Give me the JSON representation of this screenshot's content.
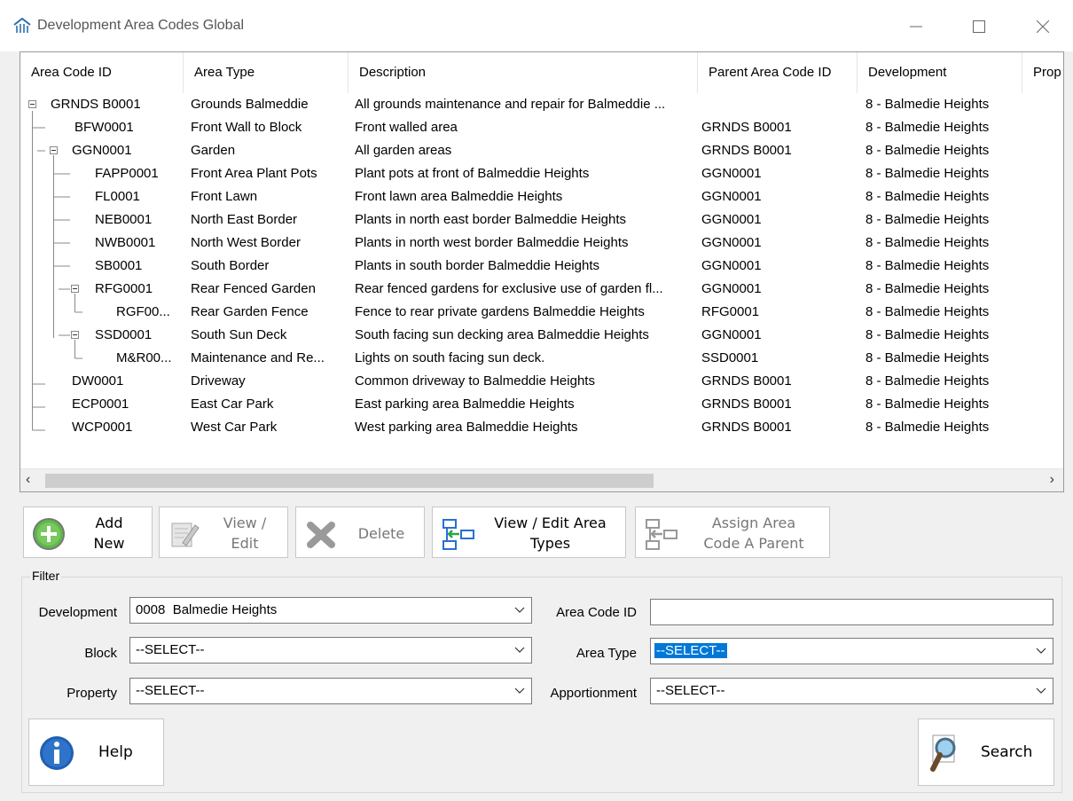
{
  "window": {
    "title": "Development Area Codes Global",
    "icon": "app-building-icon",
    "controls": [
      "minimize-icon",
      "maximize-icon",
      "close-icon"
    ]
  },
  "grid": {
    "columns": [
      "Area Code ID",
      "Area Type",
      "Description",
      "Parent Area Code ID",
      "Development",
      "Prop"
    ],
    "rows": [
      {
        "id": "GRNDS B0001",
        "type": "Grounds Balmeddie",
        "desc": "All grounds maintenance and repair for Balmeddie ...",
        "parent": "",
        "dev": "8 - Balmedie Heights"
      },
      {
        "id": "BFW0001",
        "type": "Front Wall to Block",
        "desc": "Front walled area",
        "parent": "GRNDS B0001",
        "dev": "8 - Balmedie Heights"
      },
      {
        "id": "GGN0001",
        "type": "Garden",
        "desc": "All garden areas",
        "parent": "GRNDS B0001",
        "dev": "8 - Balmedie Heights"
      },
      {
        "id": "FAPP0001",
        "type": "Front Area Plant Pots",
        "desc": "Plant pots at front of Balmeddie Heights",
        "parent": "GGN0001",
        "dev": "8 - Balmedie Heights"
      },
      {
        "id": "FL0001",
        "type": "Front Lawn",
        "desc": "Front lawn area Balmeddie Heights",
        "parent": "GGN0001",
        "dev": "8 - Balmedie Heights"
      },
      {
        "id": "NEB0001",
        "type": "North East Border",
        "desc": "Plants in north east border Balmeddie Heights",
        "parent": "GGN0001",
        "dev": "8 - Balmedie Heights"
      },
      {
        "id": "NWB0001",
        "type": "North West Border",
        "desc": "Plants in north west border Balmeddie Heights",
        "parent": "GGN0001",
        "dev": "8 - Balmedie Heights"
      },
      {
        "id": "SB0001",
        "type": "South Border",
        "desc": "Plants in south border Balmeddie Heights",
        "parent": "GGN0001",
        "dev": "8 - Balmedie Heights"
      },
      {
        "id": "RFG0001",
        "type": "Rear Fenced Garden",
        "desc": "Rear fenced gardens for exclusive use of garden fl...",
        "parent": "GGN0001",
        "dev": "8 - Balmedie Heights"
      },
      {
        "id": "RGF00...",
        "type": "Rear Garden Fence",
        "desc": "Fence to rear private gardens Balmeddie Heights",
        "parent": "RFG0001",
        "dev": "8 - Balmedie Heights"
      },
      {
        "id": "SSD0001",
        "type": "South Sun Deck",
        "desc": "South facing sun decking area Balmeddie Heights",
        "parent": "GGN0001",
        "dev": "8 - Balmedie Heights"
      },
      {
        "id": "M&R00...",
        "type": "Maintenance and Re...",
        "desc": "Lights on south facing sun deck.",
        "parent": "SSD0001",
        "dev": "8 - Balmedie Heights"
      },
      {
        "id": "DW0001",
        "type": "Driveway",
        "desc": "Common driveway to Balmeddie Heights",
        "parent": "GRNDS B0001",
        "dev": "8 - Balmedie Heights"
      },
      {
        "id": "ECP0001",
        "type": "East Car Park",
        "desc": "East parking area Balmeddie Heights",
        "parent": "GRNDS B0001",
        "dev": "8 - Balmedie Heights"
      },
      {
        "id": "WCP0001",
        "type": "West Car Park",
        "desc": "West parking area Balmeddie Heights",
        "parent": "GRNDS B0001",
        "dev": "8 - Balmedie Heights"
      }
    ]
  },
  "toolbar": {
    "add_new": {
      "line1": "Add",
      "line2": "New",
      "icon": "add-green-circle-icon"
    },
    "view_edit": {
      "line1": "View /",
      "line2": "Edit",
      "icon": "notepad-pencil-icon"
    },
    "delete": {
      "line1": "Delete",
      "icon": "delete-x-icon"
    },
    "view_edit_area_types": {
      "line1": "View / Edit Area",
      "line2": "Types",
      "icon": "hierarchy-arrow-icon"
    },
    "assign_parent": {
      "line1": "Assign Area",
      "line2": "Code A Parent",
      "icon": "hierarchy-arrow-gray-icon"
    }
  },
  "filter": {
    "legend": "Filter",
    "development_label": "Development",
    "development_value": "0008  Balmedie Heights",
    "block_label": "Block",
    "block_value": "--SELECT--",
    "property_label": "Property",
    "property_value": "--SELECT--",
    "area_code_id_label": "Area Code ID",
    "area_code_id_value": "",
    "area_type_label": "Area Type",
    "area_type_value": "--SELECT--",
    "apportionment_label": "Apportionment",
    "apportionment_value": "--SELECT--"
  },
  "footer": {
    "help_label": "Help",
    "search_label": "Search"
  }
}
